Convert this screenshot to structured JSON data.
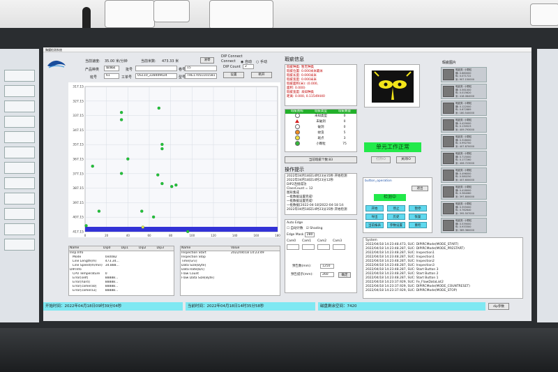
{
  "app": {
    "title": "胸膜检测系统",
    "speed_label": "当前速度:",
    "speed_value": "35.00 米/分钟",
    "length_label": "当前米数:",
    "length_value": "473.33 米",
    "reset_button": "清零",
    "dip_connect_label": "DIP Connect",
    "connect_label": "Connect",
    "auto_label": "自动",
    "manual_label": "手动",
    "dip_count_label": "DIP Count",
    "count_value": "2",
    "settings_button": "设置",
    "disconnect_button": "断开"
  },
  "product": {
    "name_label": "产品种类",
    "name_value": "玻璃皮",
    "batch_label": "批号",
    "batch_value": "",
    "roll_label": "卷号",
    "roll_value": "15",
    "team_label": "班号",
    "team_value": "61",
    "work_label": "工单号",
    "work_value": "US110_228409024",
    "model_label": "型号",
    "model_value": "THE17051101581"
  },
  "chart_data": {
    "type": "scatter",
    "title": "",
    "ylabel": "",
    "xlabel": "",
    "yticks": [
      "317.15",
      "327.15",
      "337.15",
      "347.15",
      "357.15",
      "367.15",
      "377.15",
      "387.15",
      "397.15",
      "407.15",
      "417.15"
    ],
    "xticks": [
      "0",
      "20",
      "40",
      "60",
      "80",
      "100",
      "120",
      "140",
      "160",
      "180"
    ],
    "xlim": [
      0,
      180
    ],
    "ylim": [
      317.15,
      417.15
    ],
    "series": [
      {
        "color": "#22c33a",
        "points": [
          [
            34,
            335
          ],
          [
            34,
            340
          ],
          [
            69,
            332
          ],
          [
            72,
            357
          ],
          [
            72,
            360
          ],
          [
            40,
            367
          ],
          [
            34,
            377
          ],
          [
            68,
            378
          ],
          [
            72,
            384
          ],
          [
            81,
            386
          ],
          [
            85,
            385
          ],
          [
            7,
            372
          ],
          [
            13,
            403
          ],
          [
            1,
            413
          ],
          [
            53,
            403
          ],
          [
            64,
            407
          ],
          [
            96,
            417
          ]
        ]
      },
      {
        "color": "#e6e34a",
        "points": [
          [
            54,
            414
          ]
        ]
      }
    ]
  },
  "info_table": {
    "headers": [
      "Name",
      "Dip0",
      "Dip1",
      "Dip2",
      "Dip3"
    ],
    "rows": [
      [
        "Insp.Info",
        "",
        "",
        "",
        ""
      ],
      [
        "Mode",
        "0x0082",
        "",
        "",
        ""
      ],
      [
        "Line Length(m)",
        "473.34...",
        "",
        "",
        ""
      ],
      [
        "Line Speed(m/min)",
        "34.888...",
        "",
        "",
        ""
      ],
      [
        "DIP.Info",
        "",
        "",
        "",
        ""
      ],
      [
        "CPU Temperature",
        "0",
        "",
        "",
        ""
      ],
      [
        "Error[self]",
        "88888...",
        "",
        "",
        ""
      ],
      [
        "Error[hard]",
        "88888...",
        "",
        "",
        ""
      ],
      [
        "Error[camera0]",
        "88888...",
        "",
        "",
        ""
      ],
      [
        "Error[camera1]",
        "88888...",
        "",
        "",
        ""
      ]
    ]
  },
  "time_table": {
    "headers": [
      "Name",
      "Value"
    ],
    "rows": [
      [
        "Inspection Start",
        "2022/04/18 14:23:49"
      ],
      [
        "Inspection Stop",
        ""
      ],
      [
        "Time[Grv]",
        ""
      ],
      [
        "Data Size[Byte]",
        ""
      ],
      [
        "Data Rate[b/s]",
        ""
      ],
      [
        "Flaw Count",
        ""
      ],
      [
        "Flaw Data Size[Byte]",
        ""
      ]
    ]
  },
  "status_bar": {
    "start_time": "开始时间：2022年04月18日09时39分04秒",
    "current_time": "当前时间：2022年04月18日14时35分58秒",
    "free_space_label": "磁盘剩余空间：",
    "free_space_value": "7420",
    "dip_params_button": "dip参数"
  },
  "flaw_info": {
    "title": "瑕疵信息",
    "lines": [
      "瑕疵种类: 暂无种类",
      "瑕疵位置: 0.000米米最米",
      "瑕疵长度: 0.000米米",
      "瑕疵宽度: 0.000米米",
      "瑕疵面积(米): (0.000,",
      "面积: 0.000)",
      "瑕疵宽度: 未知种类",
      "距离: 0.000, 0.11549440"
    ]
  },
  "flaw_types": {
    "headers": [
      "瑕疵图标",
      "瑕疵类型",
      "瑕疵数量"
    ],
    "rows": [
      {
        "icon": "circle-white",
        "name": "未知类型",
        "count": "0"
      },
      {
        "icon": "triangle-red",
        "name": "未破洞",
        "count": "0"
      },
      {
        "icon": "circle-white",
        "name": "破洞",
        "count": "0"
      },
      {
        "icon": "circle-orange",
        "name": "蚊虫",
        "count": "5"
      },
      {
        "icon": "circle-yellow",
        "name": "斑点",
        "count": "3"
      },
      {
        "icon": "circle-green",
        "name": "小颗粒",
        "count": "75"
      }
    ],
    "total_label": "当前瑕疵个数:83"
  },
  "logo_panel": {
    "unit_status": "单元工作正常",
    "open_io": "打开IO",
    "close_io": "关闭IO"
  },
  "ops_log": {
    "title": "操作提示",
    "lines": [
      "2022年04月18日14时23分35秒 开始检测",
      "2022年04月18日14时23分12秒",
      "DIP2连接成功",
      "ClassCount = 12",
      "图形集成",
      "一批数据设置完成!",
      "一批数据设置完成!",
      "一批数据[2022-04-18]2022-04-18 14:",
      "2022年04月18日14时23分35秒 开始检测"
    ]
  },
  "auto_edge": {
    "title": "Auto Edge",
    "auto_check": "自动计数",
    "shading_check": "Shading",
    "edge_mask_label": "Edge Mask",
    "edge_mask_value": "280",
    "cam_labels": [
      "Cam0",
      "Cam1",
      "Cam2",
      "Cam3"
    ],
    "pre_flaw_label": "预告数(mm):",
    "pre_flaw_value": "1250",
    "pre_notice_label": "预告提示(mm):",
    "pre_notice_value": "260",
    "confirm_button": "确定"
  },
  "operation": {
    "title": "button_operation",
    "exit_button": "退出",
    "status_label": "检测中",
    "buttons": [
      "开始",
      "停止",
      "暂停",
      "导出",
      "历史",
      "恢复",
      "当前报表",
      "参数设置",
      "重检"
    ]
  },
  "system_log": {
    "title": "System",
    "lines": [
      "2022/04/18 14:23:48.473, SUC: DIPIRCMode(MODE_START)",
      "2022/04/18 14:23:48.287, SUC: DIPIRCMode(MODE_PRESTART)",
      "2022/04/18 14:23:48.287, SUC: Inspection1",
      "2022/04/18 14:23:48.287, SUC: Inspection1",
      "2022/04/18 14:23:48.287, SUC: Inspection2",
      "2022/04/18 14:23:48.287, SUC: Inspection3",
      "2022/04/18 14:23:48.287, SUC: Start Button 3",
      "2022/04/18 14:23:48.287, SUC: Start Button 2",
      "2022/04/18 14:23:48.287, SUC: Start Button 1",
      "2022/04/18 14:23:37.929, SUC: Fe_FlawDataList2",
      "2022/04/18 14:23:37.929, SUC: DIPIRCMode(MODE_COUNTRESET)",
      "2022/04/18 14:23:37.929, SUC: DIPIRCMode(MODE_STOP)"
    ]
  },
  "flaw_images": {
    "title": "瑕疵图片",
    "items": [
      [
        "瑕疵类: 小颗粒",
        "横: 0.680000",
        "纵: 0.071722",
        "米: 907.150000"
      ],
      [
        "瑕疵类: 小颗粒",
        "横: 0.561000",
        "纵: 0.015620",
        "米: 418.084000"
      ],
      [
        "瑕疵类: 小颗粒",
        "横: 0.122000",
        "纵: 0.672889",
        "米: 180.540000"
      ],
      [
        "瑕疵类: 小颗粒",
        "横: 0.429000",
        "纵: 0.130523",
        "米: 409.793000"
      ],
      [
        "瑕疵类: 小颗粒",
        "横: 0.328000",
        "纵: 0.992700",
        "米: 407.870000"
      ],
      [
        "瑕疵类: 小颗粒",
        "横: 0.715000",
        "纵: 0.177260",
        "米: 406.723000"
      ],
      [
        "瑕疵类: 小颗粒",
        "横: 0.496000",
        "纵: 0.580250",
        "米: 407.600000"
      ],
      [
        "瑕疵类: 小颗粒",
        "横: 0.418000",
        "纵: 0.384060",
        "米: 397.800000"
      ],
      [
        "瑕疵类: 小颗粒",
        "横: 0.355000",
        "纵: 0.762640",
        "米: 395.507000"
      ],
      [
        "瑕疵类: 小颗粒",
        "横: 0.539000",
        "纵: 0.933300",
        "米: 389.360000"
      ]
    ]
  }
}
